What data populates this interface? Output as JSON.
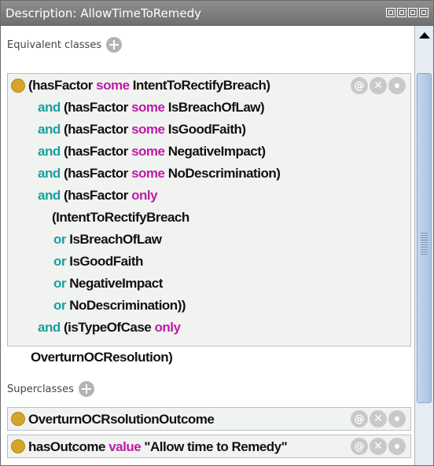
{
  "window": {
    "title": "Description: AllowTimeToRemedy"
  },
  "equivalent": {
    "header": "Equivalent classes",
    "lines": [
      [
        {
          "t": "(hasFactor ",
          "c": "plain"
        },
        {
          "t": "some",
          "c": "kw-some"
        },
        {
          "t": " IntentToRectifyBreach)",
          "c": "plain"
        }
      ],
      [
        {
          "t": "and",
          "c": "kw-and"
        },
        {
          "t": " (hasFactor ",
          "c": "plain"
        },
        {
          "t": "some",
          "c": "kw-some"
        },
        {
          "t": " IsBreachOfLaw)",
          "c": "plain"
        }
      ],
      [
        {
          "t": "and",
          "c": "kw-and"
        },
        {
          "t": " (hasFactor ",
          "c": "plain"
        },
        {
          "t": "some",
          "c": "kw-some"
        },
        {
          "t": " IsGoodFaith)",
          "c": "plain"
        }
      ],
      [
        {
          "t": "and",
          "c": "kw-and"
        },
        {
          "t": " (hasFactor ",
          "c": "plain"
        },
        {
          "t": "some",
          "c": "kw-some"
        },
        {
          "t": " NegativeImpact)",
          "c": "plain"
        }
      ],
      [
        {
          "t": "and",
          "c": "kw-and"
        },
        {
          "t": " (hasFactor ",
          "c": "plain"
        },
        {
          "t": "some",
          "c": "kw-some"
        },
        {
          "t": " NoDescrimination)",
          "c": "plain"
        }
      ],
      [
        {
          "t": "and",
          "c": "kw-and"
        },
        {
          "t": " (hasFactor ",
          "c": "plain"
        },
        {
          "t": "only",
          "c": "kw-only"
        }
      ],
      [
        {
          "t": "(IntentToRectifyBreach",
          "c": "plain"
        }
      ],
      [
        {
          "t": "or",
          "c": "kw-or"
        },
        {
          "t": " IsBreachOfLaw",
          "c": "plain"
        }
      ],
      [
        {
          "t": "or",
          "c": "kw-or"
        },
        {
          "t": " IsGoodFaith",
          "c": "plain"
        }
      ],
      [
        {
          "t": "or",
          "c": "kw-or"
        },
        {
          "t": " NegativeImpact",
          "c": "plain"
        }
      ],
      [
        {
          "t": "or",
          "c": "kw-or"
        },
        {
          "t": " NoDescrimination))",
          "c": "plain"
        }
      ],
      [
        {
          "t": "and",
          "c": "kw-and"
        },
        {
          "t": " (isTypeOfCase ",
          "c": "plain"
        },
        {
          "t": "only",
          "c": "kw-only"
        }
      ]
    ],
    "trailing": "OverturnOCResolution)"
  },
  "superclasses": {
    "header": "Superclasses",
    "items": [
      [
        {
          "t": "OverturnOCRsolutionOutcome",
          "c": "plain"
        }
      ],
      [
        {
          "t": "hasOutcome ",
          "c": "plain"
        },
        {
          "t": "value",
          "c": "kw-value"
        },
        {
          "t": " \"Allow time to Remedy\"",
          "c": "plain"
        }
      ]
    ]
  },
  "controls": {
    "annotate": "@",
    "delete": "✕",
    "edit": ""
  }
}
